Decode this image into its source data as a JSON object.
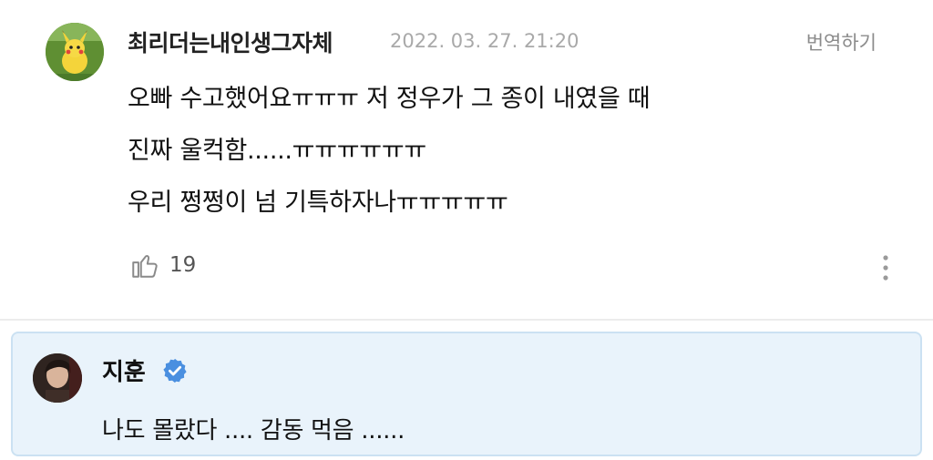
{
  "comment": {
    "username": "최리더는내인생그자체",
    "timestamp": "2022. 03. 27. 21:20",
    "translate_label": "번역하기",
    "lines": [
      "오빠 수고했어요ㅠㅠㅠ 저 정우가 그 종이 내였을 때",
      "진짜 울컥함......ㅠㅠㅠㅠㅠㅠ",
      "우리 쩡쩡이 넘 기특하자나ㅠㅠㅠㅠㅠ"
    ],
    "like_count": "19",
    "icons": {
      "like": "thumbs-up-icon",
      "more": "more-vertical-icon"
    }
  },
  "reply": {
    "username": "지훈",
    "verified_icon": "verified-badge-icon",
    "text": "나도 몰랐다 .... 감동 먹음 ......",
    "colors": {
      "background": "#e9f3fb",
      "border": "#cbe1f2",
      "badge": "#4a8fe0"
    }
  }
}
